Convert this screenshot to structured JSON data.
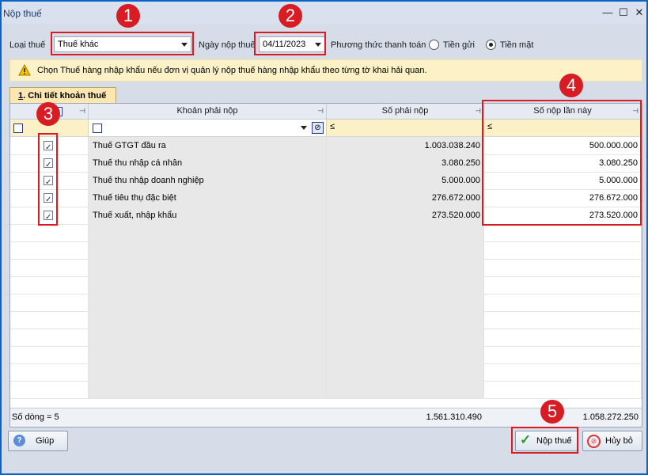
{
  "window": {
    "title": "Nộp thuế",
    "minimize": "—",
    "maximize": "☐",
    "close": "✕"
  },
  "form": {
    "tax_type_label": "Loại thuế",
    "tax_type_value": "Thuế khác",
    "date_label": "Ngày nộp thuế",
    "date_value": "04/11/2023",
    "method_label": "Phương thức thanh toán",
    "method_options": [
      "Tiền gửi",
      "Tiền mặt"
    ],
    "method_selected": "Tiền mặt"
  },
  "hint": "Chọn Thuế hàng nhập khẩu nếu đơn vị quản lý nộp thuế hàng nhập khẩu theo từng tờ khai hải quan.",
  "tab": {
    "underline": "1",
    "label": ". Chi tiết khoản thuế"
  },
  "table": {
    "headers": [
      "Khoản phải nộp",
      "Số phải nộp",
      "Số nộp lần này"
    ],
    "filter_ops": [
      "≤",
      "≤"
    ],
    "rows": [
      {
        "checked": true,
        "name": "Thuế GTGT đầu ra",
        "due": "1.003.038.240",
        "pay": "500.000.000"
      },
      {
        "checked": true,
        "name": "Thuế thu nhập cá nhân",
        "due": "3.080.250",
        "pay": "3.080.250"
      },
      {
        "checked": true,
        "name": "Thuế thu nhập doanh nghiệp",
        "due": "5.000.000",
        "pay": "5.000.000"
      },
      {
        "checked": true,
        "name": "Thuế tiêu thụ đặc biệt",
        "due": "276.672.000",
        "pay": "276.672.000"
      },
      {
        "checked": true,
        "name": "Thuế xuất, nhập khẩu",
        "due": "273.520.000",
        "pay": "273.520.000"
      }
    ],
    "footer": {
      "count": "Số dòng = 5",
      "total_due": "1.561.310.490",
      "total_pay": "1.058.272.250"
    }
  },
  "buttons": {
    "help": "Giúp",
    "submit": "Nộp thuế",
    "cancel": "Hủy bỏ"
  },
  "badges": [
    "1",
    "2",
    "3",
    "4",
    "5"
  ],
  "colors": {
    "accent_red": "#d71c24",
    "window_border": "#0a64c8",
    "hint_bg": "#fdf1c8",
    "filter_bg": "#fbf0c6"
  }
}
